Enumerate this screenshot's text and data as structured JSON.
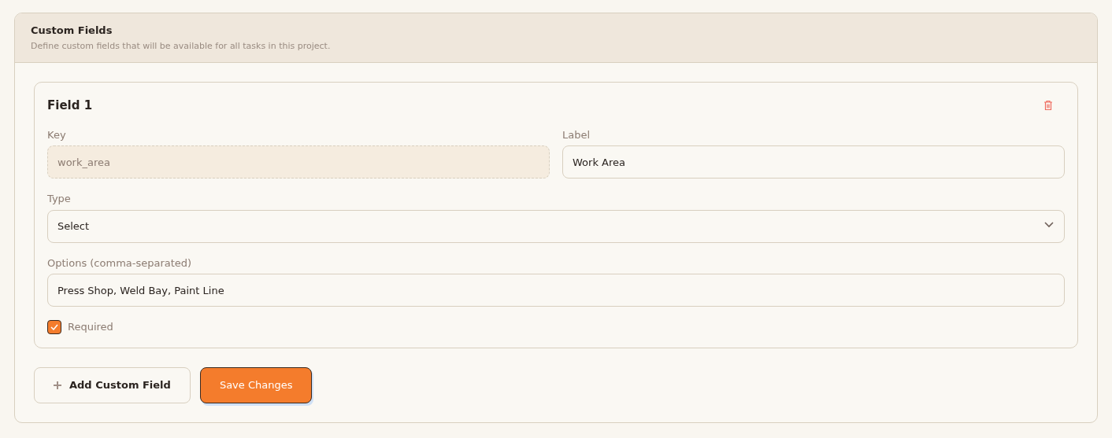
{
  "section": {
    "title": "Custom Fields",
    "description": "Define custom fields that will be available for all tasks in this project."
  },
  "fields": [
    {
      "title": "Field 1",
      "key": {
        "label": "Key",
        "value": "work_area",
        "disabled": true
      },
      "label": {
        "label": "Label",
        "value": "Work Area"
      },
      "type": {
        "label": "Type",
        "value": "Select"
      },
      "options": {
        "label": "Options (comma-separated)",
        "value": "Press Shop, Weld Bay, Paint Line"
      },
      "required": {
        "label": "Required",
        "checked": true
      }
    }
  ],
  "buttons": {
    "add": "Add Custom Field",
    "save": "Save Changes"
  }
}
